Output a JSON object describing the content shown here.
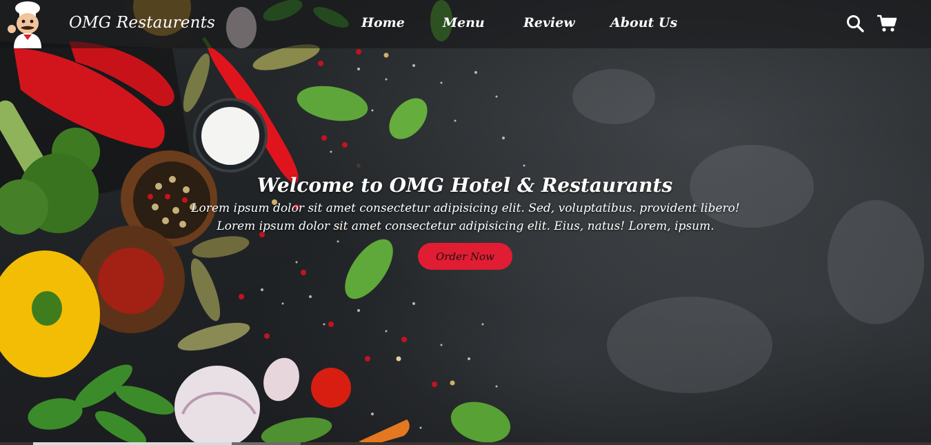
{
  "header": {
    "brand_name": "OMG Restaurents",
    "logo_icon": "chef-mascot-icon",
    "nav": [
      {
        "label": "Home"
      },
      {
        "label": "Menu"
      },
      {
        "label": "Review"
      },
      {
        "label": "About Us"
      }
    ],
    "search_icon": "search-icon",
    "cart_icon": "cart-icon"
  },
  "hero": {
    "title": "Welcome to OMG Hotel & Restaurants",
    "line1": "Lorem ipsum dolor sit amet consectetur adipisicing elit. Sed, voluptatibus. provident libero!",
    "line2": "Lorem ipsum dolor sit amet consectetur adipisicing elit. Eius, natus! Lorem, ipsum.",
    "cta_label": "Order Now",
    "background": "dark-slate-with-vegetables-and-spices"
  },
  "colors": {
    "cta": "#e11d33",
    "nav_text": "#ffffff",
    "background": "#222528"
  }
}
